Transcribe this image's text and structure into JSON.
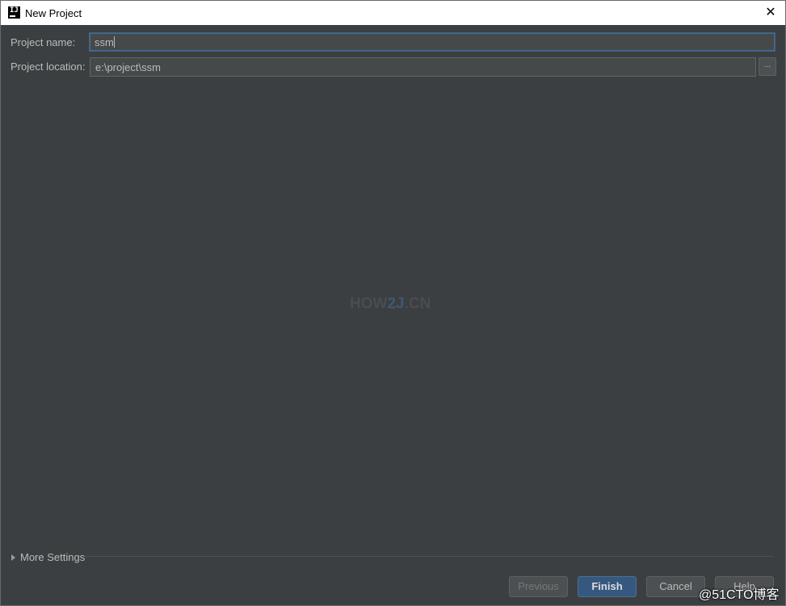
{
  "window": {
    "title": "New Project",
    "app_icon_text": "IJ",
    "close_glyph": "✕"
  },
  "form": {
    "project_name_label": "Project name:",
    "project_name_value": "ssm",
    "project_location_label": "Project location:",
    "project_location_value": "e:\\project\\ssm",
    "browse_label": "..."
  },
  "watermark": {
    "part1": "HOW",
    "part2": "2J",
    "part3": ".CN"
  },
  "more_settings": {
    "label": "More Settings",
    "icon": "triangle-right-icon"
  },
  "buttons": {
    "previous": "Previous",
    "finish": "Finish",
    "cancel": "Cancel",
    "help": "Help"
  },
  "overlay": {
    "text": "@51CTO博客"
  },
  "colors": {
    "background": "#3c3f41",
    "field": "#45494a",
    "focus_border": "#466d94",
    "default_button": "#365880",
    "text": "#bbbbbb"
  }
}
